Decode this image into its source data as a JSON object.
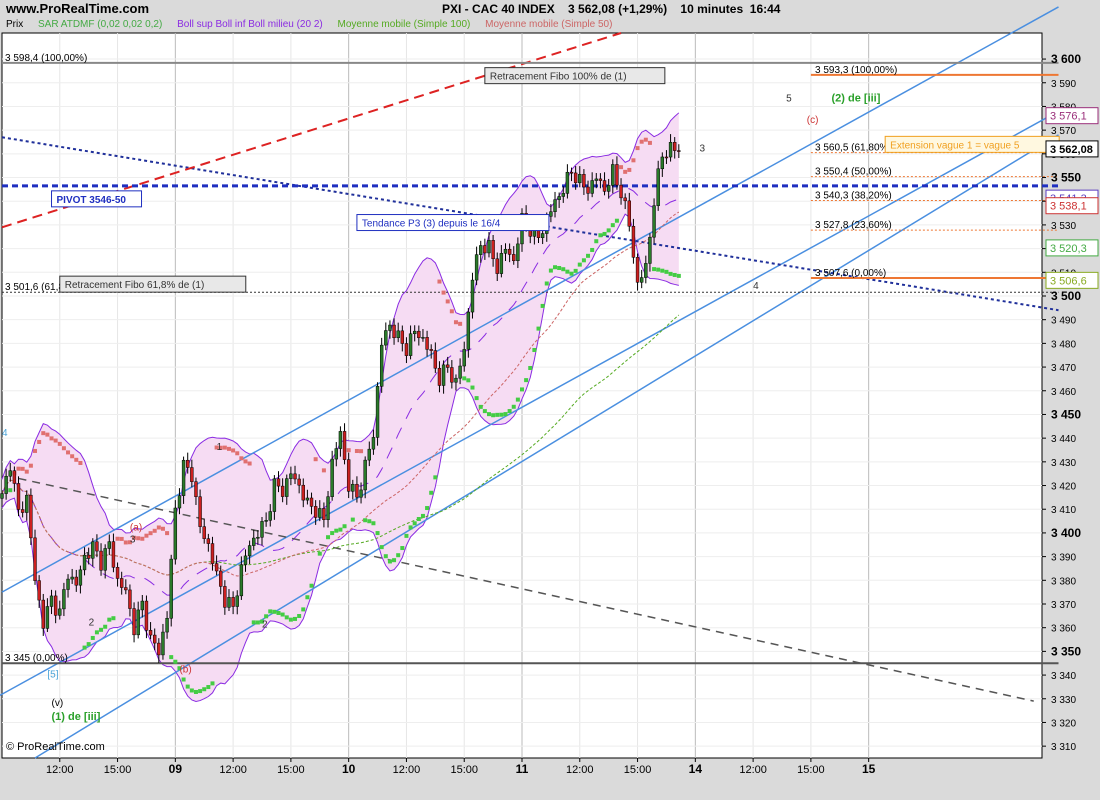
{
  "header": {
    "site": "www.ProRealTime.com",
    "title": "PXI - CAC 40 INDEX    3 562,08 (+1,29%)    10 minutes  16:44"
  },
  "legend": [
    {
      "label": "Prix",
      "color": "#000000"
    },
    {
      "label": "SAR ATDMF (0,02 0,02 0,2)",
      "color": "#44aa44"
    },
    {
      "label": "Boll sup Boll inf Boll milieu (20 2)",
      "color": "#8a2be2"
    },
    {
      "label": "Moyenne mobile (Simple 100)",
      "color": "#55aa22"
    },
    {
      "label": "Moyenne mobile (Simple 50)",
      "color": "#cc6666"
    }
  ],
  "footer": "© ProRealTime.com",
  "chart_data": {
    "type": "line",
    "subtype": "candlestick",
    "ylim": [
      3305,
      3611
    ],
    "yticks": [
      3310,
      3320,
      3330,
      3340,
      3350,
      3360,
      3370,
      3380,
      3390,
      3400,
      3410,
      3420,
      3430,
      3440,
      3450,
      3460,
      3470,
      3480,
      3490,
      3500,
      3510,
      3520,
      3530,
      3540,
      3550,
      3560,
      3570,
      3580,
      3590,
      3600
    ],
    "ytick_labels": [
      "3 310",
      "3 320",
      "3 330",
      "3 340",
      "3 350",
      "3 360",
      "3 370",
      "3 380",
      "3 390",
      "3 400",
      "3 410",
      "3 420",
      "3 430",
      "3 440",
      "3 450",
      "3 460",
      "3 470",
      "3 480",
      "3 490",
      "3 500",
      "3 510",
      "3 520",
      "3 530",
      "3 540",
      "3 550",
      "3 560",
      "3 570",
      "3 580",
      "3 590",
      "3 600"
    ],
    "ytick_bold": [
      "3 350",
      "3 400",
      "3 450",
      "3 500",
      "3 550",
      "3 600"
    ],
    "xlim": [
      0,
      252
    ],
    "xticks": [
      {
        "x": 14,
        "label": "12:00",
        "bold": false
      },
      {
        "x": 28,
        "label": "15:00",
        "bold": false
      },
      {
        "x": 42,
        "label": "09",
        "bold": true
      },
      {
        "x": 56,
        "label": "12:00",
        "bold": false
      },
      {
        "x": 70,
        "label": "15:00",
        "bold": false
      },
      {
        "x": 84,
        "label": "10",
        "bold": true
      },
      {
        "x": 98,
        "label": "12:00",
        "bold": false
      },
      {
        "x": 112,
        "label": "15:00",
        "bold": false
      },
      {
        "x": 126,
        "label": "11",
        "bold": true
      },
      {
        "x": 140,
        "label": "12:00",
        "bold": false
      },
      {
        "x": 154,
        "label": "15:00",
        "bold": false
      },
      {
        "x": 168,
        "label": "14",
        "bold": true
      },
      {
        "x": 182,
        "label": "12:00",
        "bold": false
      },
      {
        "x": 196,
        "label": "15:00",
        "bold": false
      },
      {
        "x": 210,
        "label": "15",
        "bold": true
      }
    ],
    "day_separators": [
      42,
      84,
      126,
      210
    ],
    "anchors": [
      [
        0,
        3415
      ],
      [
        2,
        3430
      ],
      [
        4,
        3408
      ],
      [
        6,
        3415
      ],
      [
        8,
        3380
      ],
      [
        10,
        3362
      ],
      [
        12,
        3372
      ],
      [
        14,
        3366
      ],
      [
        16,
        3383
      ],
      [
        18,
        3378
      ],
      [
        20,
        3390
      ],
      [
        22,
        3394
      ],
      [
        24,
        3388
      ],
      [
        26,
        3395
      ],
      [
        28,
        3380
      ],
      [
        30,
        3375
      ],
      [
        32,
        3360
      ],
      [
        34,
        3370
      ],
      [
        36,
        3355
      ],
      [
        38,
        3350
      ],
      [
        40,
        3365
      ],
      [
        42,
        3410
      ],
      [
        44,
        3428
      ],
      [
        46,
        3425
      ],
      [
        48,
        3402
      ],
      [
        50,
        3395
      ],
      [
        52,
        3382
      ],
      [
        54,
        3372
      ],
      [
        56,
        3368
      ],
      [
        58,
        3385
      ],
      [
        60,
        3395
      ],
      [
        62,
        3400
      ],
      [
        64,
        3405
      ],
      [
        66,
        3420
      ],
      [
        68,
        3418
      ],
      [
        70,
        3425
      ],
      [
        72,
        3420
      ],
      [
        74,
        3412
      ],
      [
        76,
        3410
      ],
      [
        78,
        3405
      ],
      [
        80,
        3430
      ],
      [
        82,
        3442
      ],
      [
        84,
        3420
      ],
      [
        86,
        3415
      ],
      [
        88,
        3428
      ],
      [
        90,
        3442
      ],
      [
        92,
        3480
      ],
      [
        94,
        3488
      ],
      [
        96,
        3482
      ],
      [
        98,
        3478
      ],
      [
        100,
        3485
      ],
      [
        102,
        3482
      ],
      [
        104,
        3475
      ],
      [
        106,
        3465
      ],
      [
        108,
        3470
      ],
      [
        110,
        3463
      ],
      [
        112,
        3478
      ],
      [
        114,
        3508
      ],
      [
        116,
        3522
      ],
      [
        118,
        3520
      ],
      [
        120,
        3512
      ],
      [
        122,
        3520
      ],
      [
        124,
        3515
      ],
      [
        126,
        3532
      ],
      [
        128,
        3528
      ],
      [
        130,
        3525
      ],
      [
        132,
        3532
      ],
      [
        134,
        3540
      ],
      [
        136,
        3545
      ],
      [
        138,
        3553
      ],
      [
        140,
        3548
      ],
      [
        142,
        3545
      ],
      [
        144,
        3550
      ],
      [
        146,
        3545
      ],
      [
        148,
        3552
      ],
      [
        150,
        3544
      ],
      [
        152,
        3530
      ],
      [
        154,
        3505
      ],
      [
        156,
        3512
      ],
      [
        158,
        3540
      ],
      [
        160,
        3560
      ],
      [
        162,
        3562
      ]
    ],
    "candle_last_index": 164,
    "trendlines": [
      {
        "name": "channel-upper",
        "points": [
          [
            0,
            3375
          ],
          [
            256,
            3622
          ]
        ],
        "color": "#4a8fe0",
        "dash": ""
      },
      {
        "name": "channel-lower",
        "points": [
          [
            8,
            3305
          ],
          [
            256,
            3568
          ]
        ],
        "color": "#4a8fe0",
        "dash": ""
      },
      {
        "name": "channel-mid",
        "points": [
          [
            -2,
            3330
          ],
          [
            256,
            3578
          ]
        ],
        "color": "#4a8fe0",
        "dash": ""
      },
      {
        "name": "tendance-p3",
        "points": [
          [
            0,
            3567
          ],
          [
            256,
            3494
          ]
        ],
        "color": "#1f2f9a",
        "dash": "3,3"
      },
      {
        "name": "red-dashed-trend",
        "points": [
          [
            0,
            3529
          ],
          [
            150,
            3611
          ]
        ],
        "color": "#dd2222",
        "dash": "10,6"
      },
      {
        "name": "black-dashed-trend",
        "points": [
          [
            4,
            3423
          ],
          [
            250,
            3329
          ]
        ],
        "color": "#555555",
        "dash": "8,6"
      }
    ],
    "horizontal_lines": [
      {
        "name": "fibo-100",
        "y": 3598.4,
        "x0": 0,
        "x1": 256,
        "color": "#888888",
        "dash": "",
        "width": 2
      },
      {
        "name": "fibo-0",
        "y": 3345,
        "x0": 0,
        "x1": 256,
        "color": "#555555",
        "dash": "",
        "width": 2
      },
      {
        "name": "pivot-line",
        "y": 3546.5,
        "x0": 0,
        "x1": 256,
        "color": "#1f2fc0",
        "dash": "6,4",
        "width": 3
      },
      {
        "name": "fibo-61-8",
        "y": 3501.6,
        "x0": 0,
        "x1": 256,
        "color": "#333333",
        "dash": "2,2",
        "width": 1
      },
      {
        "name": "orange-fibo-100",
        "y": 3593.3,
        "x0": 196,
        "x1": 256,
        "color": "#ee7733",
        "dash": "",
        "width": 2
      },
      {
        "name": "orange-fibo-618",
        "y": 3560.5,
        "x0": 196,
        "x1": 256,
        "color": "#ee7733",
        "dash": "2,2",
        "width": 1
      },
      {
        "name": "orange-fibo-50",
        "y": 3550.4,
        "x0": 196,
        "x1": 256,
        "color": "#ee7733",
        "dash": "2,2",
        "width": 1
      },
      {
        "name": "orange-fibo-382",
        "y": 3540.3,
        "x0": 196,
        "x1": 256,
        "color": "#ee7733",
        "dash": "2,2",
        "width": 1
      },
      {
        "name": "orange-fibo-236",
        "y": 3527.8,
        "x0": 196,
        "x1": 256,
        "color": "#ee7733",
        "dash": "2,2",
        "width": 1
      },
      {
        "name": "orange-fibo-0",
        "y": 3507.6,
        "x0": 196,
        "x1": 256,
        "color": "#ee7733",
        "dash": "",
        "width": 2
      }
    ],
    "fibo_labels": [
      {
        "text": "3 593,3 (100,00%)",
        "y": 3593.3
      },
      {
        "text": "3 560,5 (61,80%)",
        "y": 3560.5
      },
      {
        "text": "3 550,4 (50,00%)",
        "y": 3550.4
      },
      {
        "text": "3 540,3 (38,20%)",
        "y": 3540.3
      },
      {
        "text": "3 527,8 (23,60%)",
        "y": 3527.8
      },
      {
        "text": "3 507,6 (0,00%)",
        "y": 3507.6
      }
    ],
    "left_labels": [
      {
        "text": "3 598,4 (100,00%)",
        "y": 3598.4
      },
      {
        "text": "3 345 (0,00%)",
        "y": 3345
      },
      {
        "text": "3 501,6 (61,80%)",
        "y": 3501.6
      }
    ],
    "boxes": [
      {
        "name": "retracement-100-box",
        "text": "Retracement Fibo 100% de (1)",
        "x": 117,
        "y": 3593,
        "color": "#333333",
        "bg": "#e8e8e8"
      },
      {
        "name": "retracement-618-box",
        "text": "Retracement Fibo 61,8% de (1)",
        "x": 14,
        "y": 3505,
        "color": "#333333",
        "bg": "#e8e8e8"
      },
      {
        "name": "pivot-box",
        "text": "PIVOT 3546-50",
        "x": 12,
        "y": 3541,
        "color": "#1f2fc0",
        "bg": "#ffffff"
      },
      {
        "name": "tendance-box",
        "text": "Tendance P3 (3) depuis le 16/4",
        "x": 86,
        "y": 3531,
        "color": "#1f2fc0",
        "bg": "#ffffff"
      },
      {
        "name": "extension-box",
        "text": "Extension vague 1 = vague 5",
        "x": 214,
        "y": 3564,
        "color": "#f0a020",
        "bg": "#fff8e0"
      }
    ],
    "price_tags": [
      {
        "text": "3 576,1",
        "y": 3576.1,
        "color": "#9a2f7a"
      },
      {
        "text": "3 562,08",
        "y": 3562.08,
        "color": "#000000",
        "bold": true
      },
      {
        "text": "3 541,3",
        "y": 3541.3,
        "color": "#5a3dc0"
      },
      {
        "text": "3 538,1",
        "y": 3538.1,
        "color": "#cc3333"
      },
      {
        "text": "3 520,3",
        "y": 3520.3,
        "color": "#44aa44"
      },
      {
        "text": "3 506,6",
        "y": 3506.6,
        "color": "#88aa22"
      }
    ],
    "wave_labels": [
      {
        "text": "1",
        "x": 52,
        "y": 3435,
        "color": "#333333"
      },
      {
        "text": "1",
        "x": 20,
        "y": 3389,
        "color": "#333333"
      },
      {
        "text": "2",
        "x": 21,
        "y": 3361,
        "color": "#333333"
      },
      {
        "text": "2",
        "x": 63,
        "y": 3360,
        "color": "#333333"
      },
      {
        "text": "3",
        "x": 31,
        "y": 3396,
        "color": "#333333"
      },
      {
        "text": "3",
        "x": 169,
        "y": 3561,
        "color": "#333333"
      },
      {
        "text": "4",
        "x": 182,
        "y": 3503,
        "color": "#333333"
      },
      {
        "text": "5",
        "x": 190,
        "y": 3582,
        "color": "#333333"
      },
      {
        "text": "(a)",
        "x": 31,
        "y": 3401,
        "color": "#cc3333"
      },
      {
        "text": "(b)",
        "x": 43,
        "y": 3341,
        "color": "#cc3333"
      },
      {
        "text": "(c)",
        "x": 195,
        "y": 3573,
        "color": "#cc3333"
      },
      {
        "text": "(v)",
        "x": 12,
        "y": 3327,
        "color": "#000000"
      },
      {
        "text": "[5]",
        "x": 11,
        "y": 3339,
        "color": "#4aa3d8"
      },
      {
        "text": "4",
        "x": 0,
        "y": 3441,
        "color": "#4aa3d8"
      },
      {
        "text": "(2) de [iii]",
        "x": 201,
        "y": 3582,
        "color": "#2aa02a",
        "bold": true
      },
      {
        "text": "(1) de [iii]",
        "x": 12,
        "y": 3321,
        "color": "#2aa02a",
        "bold": true
      }
    ]
  }
}
